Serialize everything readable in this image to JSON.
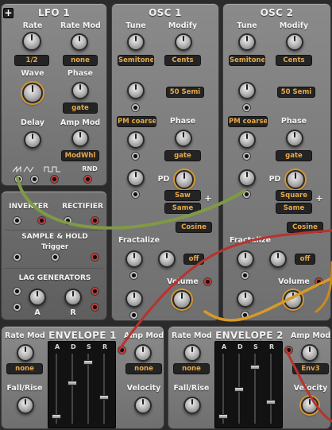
{
  "add_button": "+",
  "lfo1": {
    "title": "LFO 1",
    "rate_label": "Rate",
    "rate_value": "1/2",
    "ratemod_label": "Rate Mod",
    "ratemod_value": "none",
    "wave_label": "Wave",
    "phase_label": "Phase",
    "phase_value": "gate",
    "delay_label": "Delay",
    "ampmod_label": "Amp Mod",
    "ampmod_value": "ModWhl",
    "rnd_label": "RND"
  },
  "utilities": {
    "inverter": "INVERTER",
    "rectifier": "RECTIFIER",
    "sample_hold": "SAMPLE & HOLD",
    "trigger": "Trigger",
    "lag": "LAG GENERATORS",
    "a": "A",
    "r": "R"
  },
  "osc1": {
    "title": "OSC 1",
    "tune_label": "Tune",
    "tune_value": "Semitone",
    "modify_label": "Modify",
    "modify_value": "Cents",
    "semi_value": "50 Semi",
    "pm_value": "PM coarse",
    "phase_label": "Phase",
    "phase_value": "gate",
    "pd_label": "PD",
    "wave_value": "Saw",
    "sync_value": "Same",
    "shape_value": "Cosine",
    "fractalize_label": "Fractalize",
    "fractalize_value": "off",
    "volume_label": "Volume"
  },
  "osc2": {
    "title": "OSC 2",
    "tune_label": "Tune",
    "tune_value": "Semitone",
    "modify_label": "Modify",
    "modify_value": "Cents",
    "semi_value": "50 Semi",
    "pm_value": "PM coarse",
    "phase_label": "Phase",
    "phase_value": "gate",
    "pd_label": "PD",
    "wave_value": "Square",
    "sync_value": "Same",
    "shape_value": "Cosine",
    "fractalize_label": "Fractalize",
    "fractalize_value": "off",
    "volume_label": "Volume"
  },
  "env1": {
    "title": "ENVELOPE 1",
    "ratemod_label": "Rate Mod",
    "ratemod_value": "none",
    "ampmod_label": "Amp Mod",
    "ampmod_value": "none",
    "fallrise_label": "Fall/Rise",
    "velocity_label": "Velocity",
    "a": "A",
    "d": "D",
    "s": "S",
    "r": "R",
    "levels": [
      0.08,
      0.6,
      0.92,
      0.38
    ]
  },
  "env2": {
    "title": "ENVELOPE 2",
    "ratemod_label": "Rate Mod",
    "ratemod_value": "none",
    "ampmod_label": "Amp Mod",
    "ampmod_value": "Env3",
    "fallrise_label": "Fall/Rise",
    "velocity_label": "Velocity",
    "a": "A",
    "d": "D",
    "s": "S",
    "r": "R",
    "levels": [
      0.08,
      0.5,
      0.85,
      0.3
    ]
  },
  "colors": {
    "accent": "#e6a94a",
    "cable_green": "#7f9a45",
    "cable_orange": "#d89a26",
    "cable_red": "#b8322e",
    "jack_red": "#c43a3a"
  }
}
